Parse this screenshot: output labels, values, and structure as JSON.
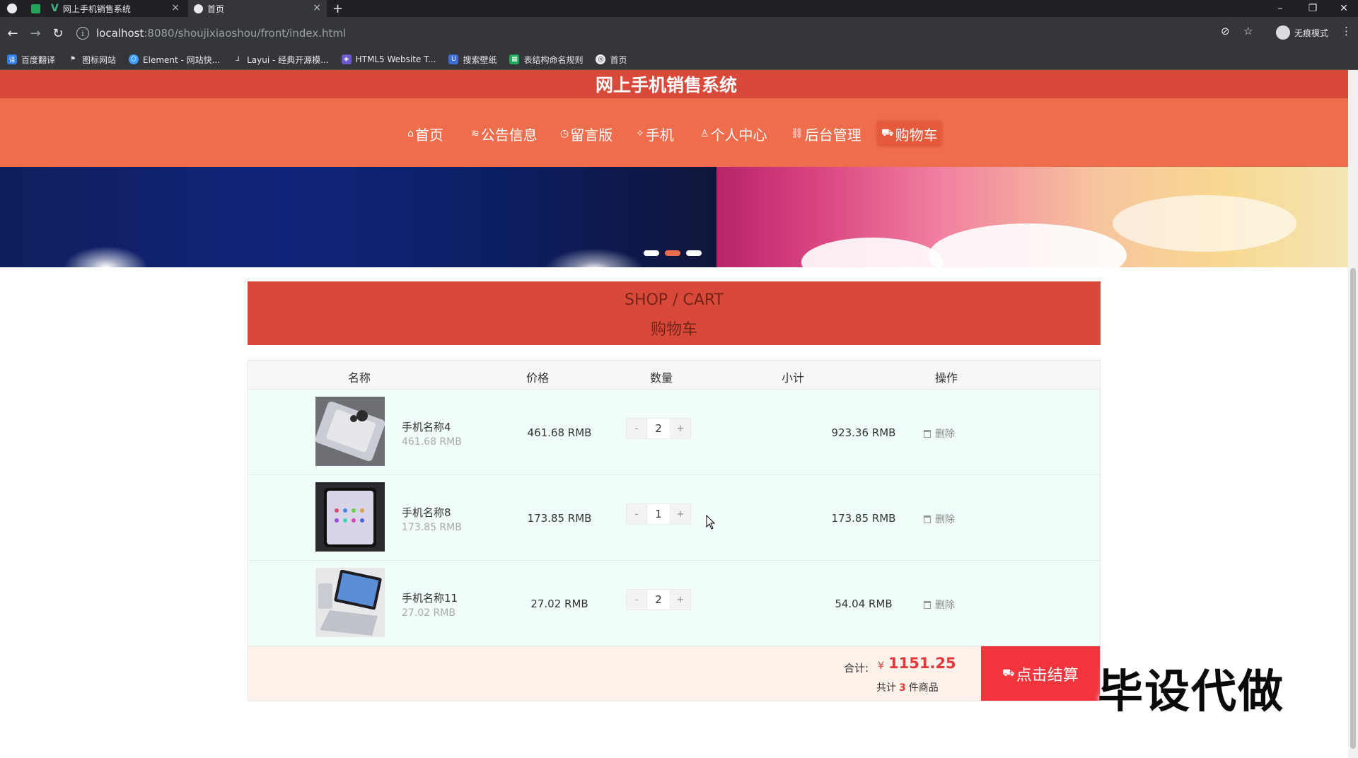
{
  "browser": {
    "tabs": [
      {
        "title": "",
        "active": false
      },
      {
        "title": "网上手机销售系统",
        "active": false
      },
      {
        "title": "首页",
        "active": true
      }
    ],
    "url_host": "localhost",
    "url_path": ":8080/shoujixiaoshou/front/index.html",
    "profile_label": "无痕模式",
    "bookmarks": [
      {
        "label": "百度翻译",
        "icon": "baidu-translate-icon",
        "color": "#2f7cf6"
      },
      {
        "label": "图标网站",
        "icon": "flag-icon",
        "color": "#e8eaed"
      },
      {
        "label": "Element - 网站快...",
        "icon": "element-icon",
        "color": "#409eff"
      },
      {
        "label": "Layui - 经典开源模...",
        "icon": "layui-icon",
        "color": "#5fb878"
      },
      {
        "label": "HTML5 Website T...",
        "icon": "html5-icon",
        "color": "#6a5acd"
      },
      {
        "label": "搜索壁纸",
        "icon": "wallpaper-icon",
        "color": "#3b6fd6"
      },
      {
        "label": "表结构命名规则",
        "icon": "sheet-icon",
        "color": "#23a55a"
      },
      {
        "label": "首页",
        "icon": "globe-icon",
        "color": "#e8eaed"
      }
    ]
  },
  "site": {
    "title": "网上手机销售系统",
    "nav": [
      {
        "label": "首页",
        "icon": "home-icon",
        "glyph": "⌂"
      },
      {
        "label": "公告信息",
        "icon": "notice-icon",
        "glyph": "≋"
      },
      {
        "label": "留言版",
        "icon": "message-icon",
        "glyph": "◷"
      },
      {
        "label": "手机",
        "icon": "phone-icon",
        "glyph": "✧"
      },
      {
        "label": "个人中心",
        "icon": "user-icon",
        "glyph": "♙"
      },
      {
        "label": "后台管理",
        "icon": "link-icon",
        "glyph": "⛓"
      },
      {
        "label": "购物车",
        "icon": "cart-icon",
        "glyph": "⛟",
        "active": true
      }
    ]
  },
  "cart": {
    "title_en": "SHOP / CART",
    "title_zh": "购物车",
    "columns": [
      "名称",
      "价格",
      "数量",
      "小计",
      "操作"
    ],
    "items": [
      {
        "name": "手机名称4",
        "sub_price": "461.68 RMB",
        "price": "461.68 RMB",
        "qty": "2",
        "subtotal": "923.36 RMB",
        "action": "删除"
      },
      {
        "name": "手机名称8",
        "sub_price": "173.85 RMB",
        "price": "173.85 RMB",
        "qty": "1",
        "subtotal": "173.85 RMB",
        "action": "删除"
      },
      {
        "name": "手机名称11",
        "sub_price": "27.02 RMB",
        "price": "27.02 RMB",
        "qty": "2",
        "subtotal": "54.04 RMB",
        "action": "删除"
      }
    ],
    "minus": "-",
    "plus": "+",
    "total_label": "合计:",
    "currency": "¥",
    "total": "1151.25",
    "count_prefix": "共计",
    "count": "3",
    "count_suffix": "件商品",
    "checkout_label": "点击结算"
  },
  "watermark": "毕设代做",
  "colors": {
    "header_dark": "#d9493a",
    "nav_orange": "#ee6d4c",
    "checkout_red": "#f2353d",
    "row_bg": "#f0fdf9"
  }
}
